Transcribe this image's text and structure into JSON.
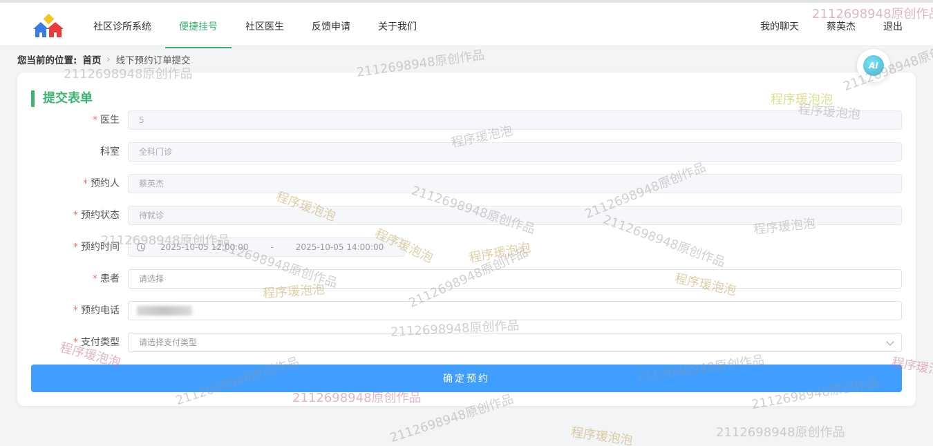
{
  "nav": {
    "items": [
      "社区诊所系统",
      "便捷挂号",
      "社区医生",
      "反馈申请",
      "关于我们"
    ],
    "right": [
      "我的聊天",
      "蔡英杰",
      "退出"
    ]
  },
  "breadcrumb": {
    "label": "您当前的位置:",
    "home": "首页",
    "current": "线下预约订单提交"
  },
  "form": {
    "title": "提交表单",
    "doctor": {
      "label": "医生",
      "value": "5"
    },
    "department": {
      "label": "科室",
      "value": "全科门诊"
    },
    "booker": {
      "label": "预约人",
      "value": "蔡英杰"
    },
    "status": {
      "label": "预约状态",
      "value": "待就诊"
    },
    "time": {
      "label": "预约时间",
      "start": "2025-10-05 12:00:00",
      "sep": "-",
      "end": "2025-10-05 14:00:00"
    },
    "patient": {
      "label": "患者",
      "placeholder": "请选择"
    },
    "phone": {
      "label": "预约电话"
    },
    "payment": {
      "label": "支付类型",
      "placeholder": "请选择支付类型"
    },
    "submit": "确定预约"
  },
  "ai_button": "AI",
  "watermarks": {
    "id_text": "2112698948原创作品",
    "brand_text": "程序瑗泡泡"
  },
  "colors": {
    "accent_green": "#3cb371",
    "primary_blue": "#409eff",
    "required_red": "#f56c6c"
  }
}
